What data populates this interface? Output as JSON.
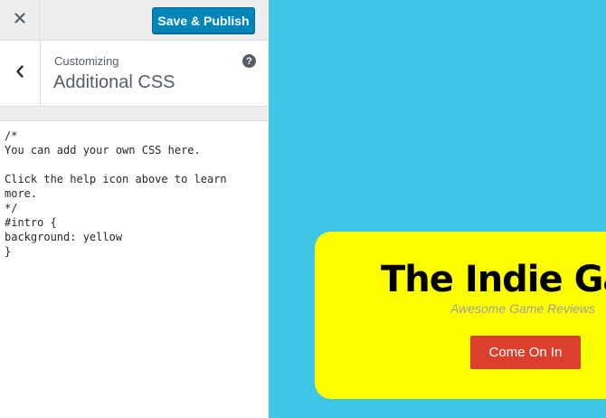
{
  "toolbar": {
    "close_icon": "close-icon",
    "publish_label": "Save & Publish"
  },
  "section": {
    "back_icon": "chevron-left-icon",
    "breadcrumb": "Customizing",
    "title": "Additional CSS",
    "help_icon": "question-circle-icon",
    "help_glyph": "?"
  },
  "editor": {
    "value": "/*\nYou can add your own CSS here.\n\nClick the help icon above to learn more.\n*/\n#intro {\nbackground: yellow\n}"
  },
  "preview": {
    "site_title": "The Indie Game Hub",
    "tagline": "Awesome Game Reviews",
    "cta_label": "Come On In"
  },
  "colors": {
    "publish_button": "#0085ba",
    "preview_background": "#3ec6e7",
    "intro_background": "#ffff00",
    "cta_background": "#dd3f2d"
  }
}
